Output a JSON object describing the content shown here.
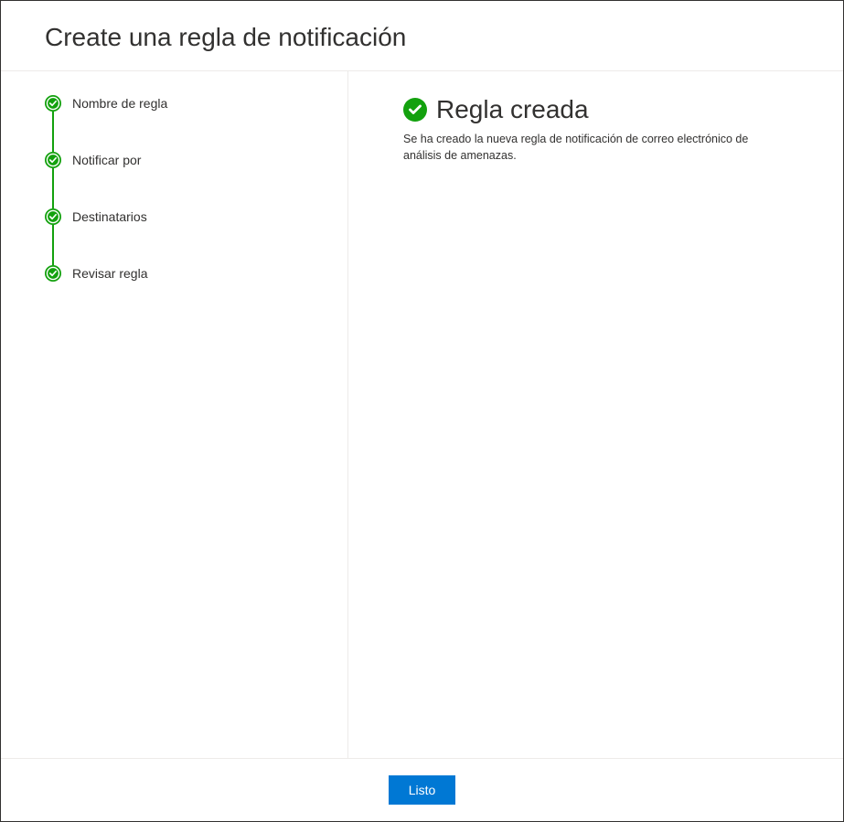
{
  "header": {
    "title": "Create una regla de notificación"
  },
  "sidebar": {
    "steps": [
      {
        "label": "Nombre de regla"
      },
      {
        "label": "Notificar por"
      },
      {
        "label": "Destinatarios"
      },
      {
        "label": "Revisar regla"
      }
    ]
  },
  "main": {
    "success_title": "Regla creada",
    "success_description": "Se ha creado la nueva regla de notificación de correo electrónico de análisis de amenazas."
  },
  "footer": {
    "done_label": "Listo"
  },
  "colors": {
    "success_green": "#13a10e",
    "primary_blue": "#0078d4"
  }
}
